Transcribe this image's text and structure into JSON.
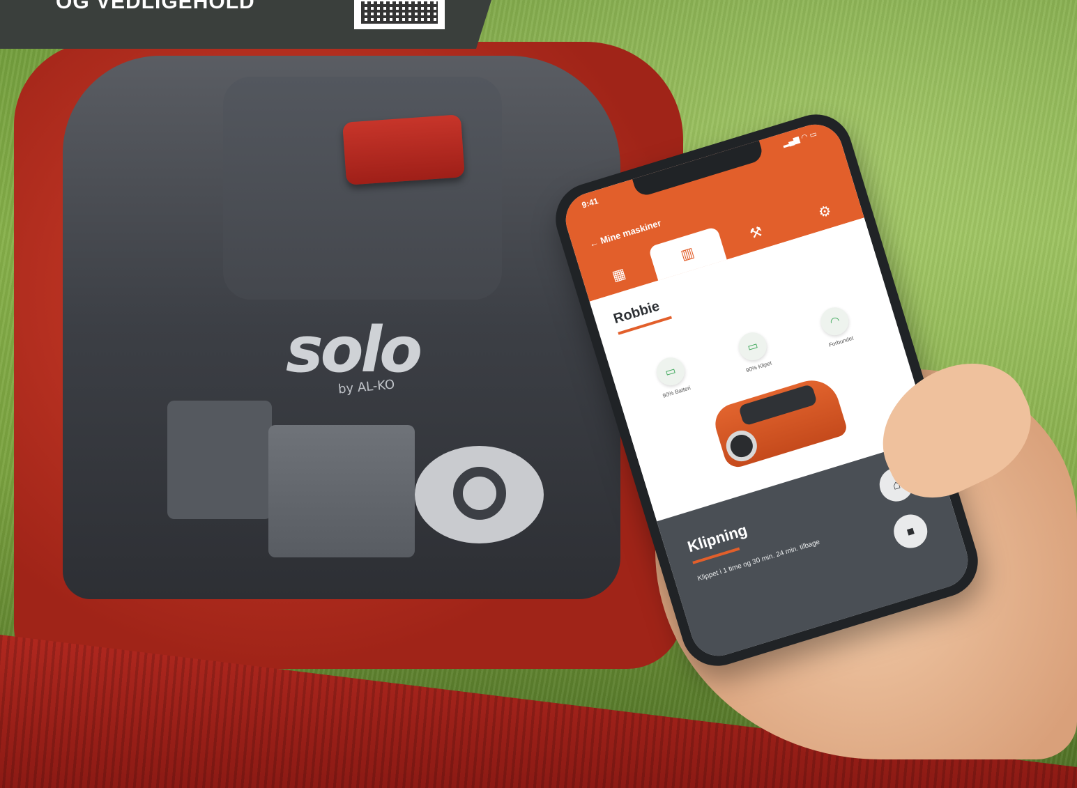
{
  "banner": {
    "title": "OG VEDLIGEHOLD",
    "qr_code": "qr-code"
  },
  "mower": {
    "brand": "solo",
    "brand_sub": "by AL-KO"
  },
  "phone": {
    "status": {
      "time": "9:41",
      "icons": "signal wifi battery"
    },
    "header": {
      "back_label": "Mine maskiner"
    },
    "tabs": [
      {
        "icon": "dashboard-icon",
        "glyph": "▦"
      },
      {
        "icon": "stats-icon",
        "glyph": "▥"
      },
      {
        "icon": "wrench-icon",
        "glyph": "⚒"
      },
      {
        "icon": "settings-icon",
        "glyph": "⚙"
      }
    ],
    "machine": {
      "name": "Robbie"
    },
    "stats": [
      {
        "icon": "battery-icon",
        "glyph": "▭",
        "label": "90% Batteri"
      },
      {
        "icon": "battery-icon",
        "glyph": "▭",
        "label": "90% Klipet"
      },
      {
        "icon": "wifi-icon",
        "glyph": "◠",
        "label": "Forbundet"
      }
    ],
    "status_panel": {
      "title": "Klipning",
      "detail": "Klippet i 1 time og 30 min. 24 min. tilbage"
    },
    "controls": {
      "home_glyph": "⌂",
      "stop_glyph": "■"
    },
    "colors": {
      "accent": "#e25f2b",
      "panel": "#4a4f55"
    }
  }
}
